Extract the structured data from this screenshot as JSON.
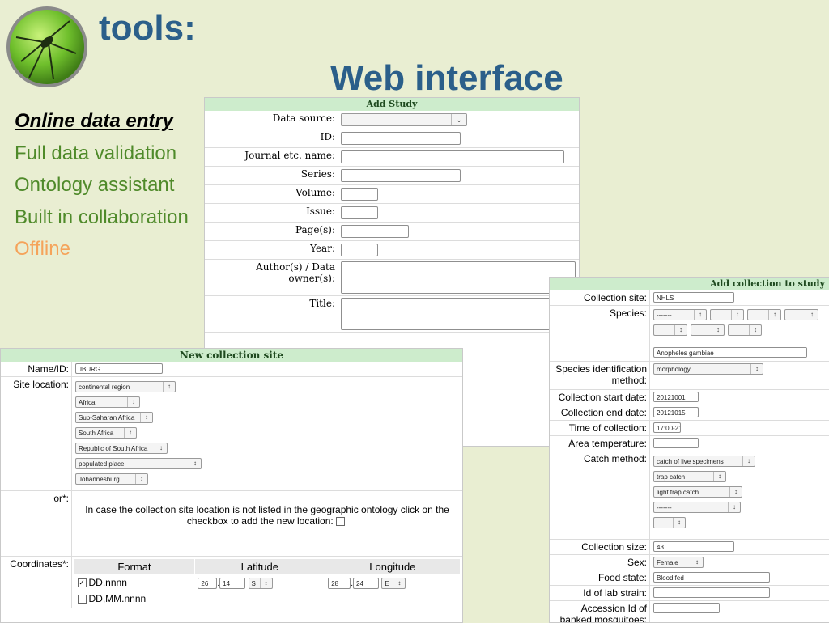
{
  "slide": {
    "title_line1": "tools:",
    "title_line2": "Web interface",
    "bullets": [
      {
        "label": "Online data entry",
        "style": "heading"
      },
      {
        "label": "Full data validation",
        "style": "normal"
      },
      {
        "label": "Ontology assistant",
        "style": "normal"
      },
      {
        "label": "Built in collaboration",
        "style": "normal"
      },
      {
        "label": "Offline",
        "style": "disabled"
      }
    ],
    "colors": {
      "title": "#2b5f8a",
      "bullet": "#4f8a2a",
      "offline": "#f5a35a",
      "background": "#e9eed2",
      "header_bg": "#cdeccc"
    }
  },
  "add_study": {
    "header": "Add Study",
    "fields": {
      "data_source": "Data source:",
      "id": "ID:",
      "journal": "Journal etc. name:",
      "series": "Series:",
      "volume": "Volume:",
      "issue": "Issue:",
      "pages": "Page(s):",
      "year": "Year:",
      "authors": "Author(s) / Data owner(s):",
      "title": "Title:"
    }
  },
  "new_site": {
    "header": "New collection site",
    "name_label": "Name/ID:",
    "name_value": "JBURG",
    "location_label": "Site location:",
    "location_selects": [
      "continental region",
      "Africa",
      "Sub-Saharan Africa",
      "South Africa",
      "Republic of South Africa",
      "populated place",
      "Johannesburg"
    ],
    "or_label": "or*:",
    "or_text": "In case the collection site location is not listed in the geographic ontology click on the checkbox to add the new location:",
    "coords_label": "Coordinates*:",
    "coord_headers": [
      "Format",
      "Latitude",
      "Longitude"
    ],
    "formats": [
      {
        "label": "DD.nnnn",
        "checked": true
      },
      {
        "label": "DD,MM.nnnn",
        "checked": false
      }
    ],
    "lat": {
      "deg": "26",
      "min": "14",
      "dir": "S"
    },
    "lon": {
      "deg": "28",
      "min": "24",
      "dir": "E"
    }
  },
  "add_collection": {
    "header": "Add collection to study",
    "site_label": "Collection site:",
    "site_value": "NHLS",
    "species_label": "Species:",
    "species_select": "-------",
    "species_value": "Anopheles gambiae",
    "species_method_label": "Species identification method:",
    "species_method_value": "morphology",
    "start_label": "Collection start date:",
    "start_value": "20121001",
    "end_label": "Collection end date:",
    "end_value": "20121015",
    "time_label": "Time of collection:",
    "time_value": "17:00-21",
    "temp_label": "Area temperature:",
    "catch_label": "Catch method:",
    "catch_values": [
      "catch of live specimens",
      "trap catch",
      "light trap catch",
      "-------"
    ],
    "size_label": "Collection size:",
    "size_value": "43",
    "sex_label": "Sex:",
    "sex_value": "Female",
    "food_label": "Food state:",
    "food_value": "Blood fed",
    "strain_label": "Id of lab strain:",
    "accession_label": "Accession Id of banked mosquitoes:"
  }
}
